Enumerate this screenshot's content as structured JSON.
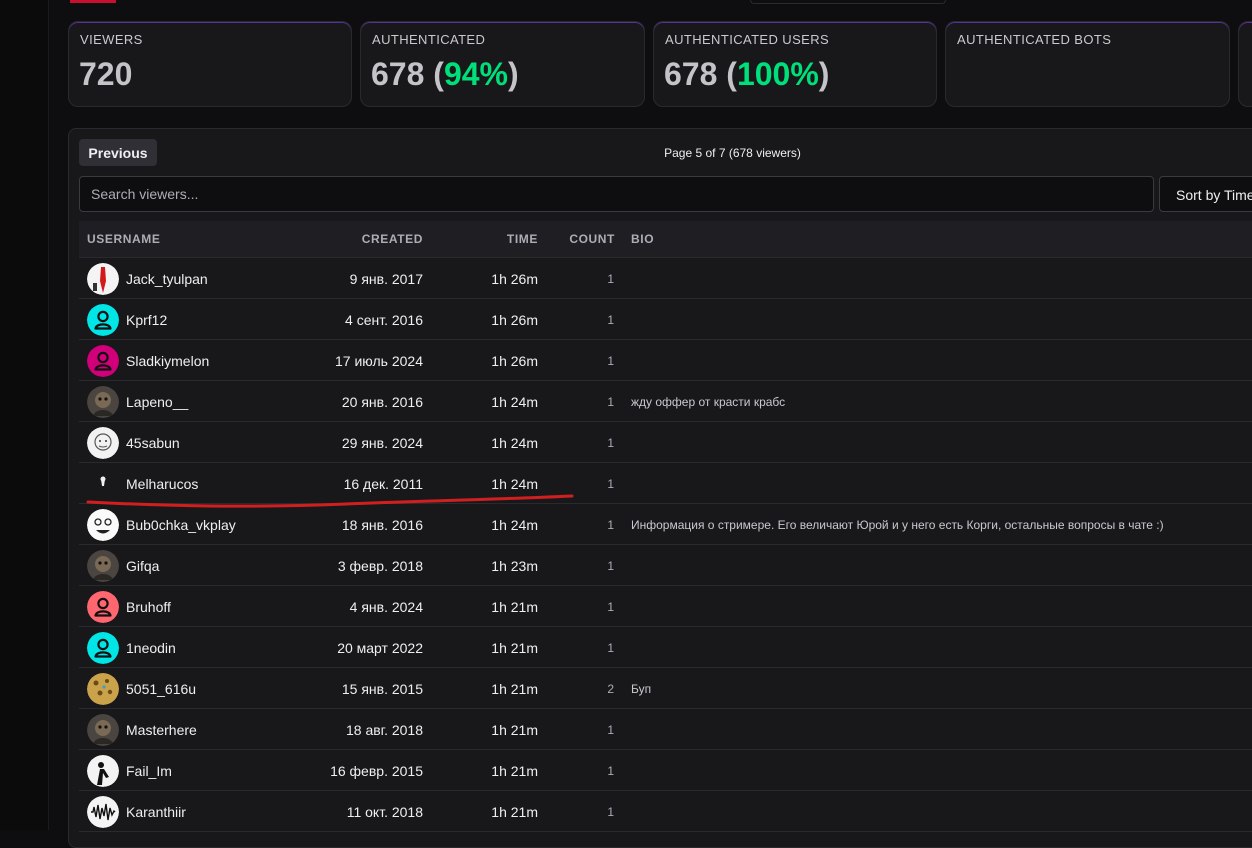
{
  "stats": [
    {
      "label": "VIEWERS",
      "value": "720",
      "pct": ""
    },
    {
      "label": "AUTHENTICATED",
      "value": "678",
      "pct": "94%"
    },
    {
      "label": "AUTHENTICATED USERS",
      "value": "678",
      "pct": "100%"
    },
    {
      "label": "AUTHENTICATED BOTS",
      "value": "",
      "pct": ""
    }
  ],
  "pagination": {
    "previous_label": "Previous",
    "page_info": "Page 5 of 7 (678 viewers)"
  },
  "search": {
    "placeholder": "Search viewers..."
  },
  "sort": {
    "label": "Sort by Time"
  },
  "table": {
    "headers": {
      "username": "USERNAME",
      "created": "CREATED",
      "time": "TIME",
      "count": "COUNT",
      "bio": "BIO"
    },
    "rows": [
      {
        "username": "Jack_tyulpan",
        "created": "9 янв. 2017",
        "time": "1h 26m",
        "count": "1",
        "bio": "",
        "avatar": "red-figure-avatar"
      },
      {
        "username": "Kprf12",
        "created": "4 сент. 2016",
        "time": "1h 26m",
        "count": "1",
        "bio": "",
        "avatar": "default-user-avatar"
      },
      {
        "username": "Sladkiymelon",
        "created": "17 июль 2024",
        "time": "1h 26m",
        "count": "1",
        "bio": "",
        "avatar": "default-user-avatar"
      },
      {
        "username": "Lapeno__",
        "created": "20 янв. 2016",
        "time": "1h 24m",
        "count": "1",
        "bio": "жду оффер от красти крабс",
        "avatar": "photo-avatar"
      },
      {
        "username": "45sabun",
        "created": "29 янв. 2024",
        "time": "1h 24m",
        "count": "1",
        "bio": "",
        "avatar": "drawing-avatar"
      },
      {
        "username": "Melharucos",
        "created": "16 дек. 2011",
        "time": "1h 24m",
        "count": "1",
        "bio": "",
        "avatar": "dark-avatar"
      },
      {
        "username": "Bub0chka_vkplay",
        "created": "18 янв. 2016",
        "time": "1h 24m",
        "count": "1",
        "bio": "Информация о стримере. Его величают Юрой и у него есть Корги, остальные вопросы в чате :)",
        "avatar": "meme-face-avatar"
      },
      {
        "username": "Gifqa",
        "created": "3 февр. 2018",
        "time": "1h 23m",
        "count": "1",
        "bio": "",
        "avatar": "photo-avatar"
      },
      {
        "username": "Bruhoff",
        "created": "4 янв. 2024",
        "time": "1h 21m",
        "count": "1",
        "bio": "",
        "avatar": "default-user-avatar"
      },
      {
        "username": "1neodin",
        "created": "20 март 2022",
        "time": "1h 21m",
        "count": "1",
        "bio": "",
        "avatar": "default-user-avatar"
      },
      {
        "username": "5051_616u",
        "created": "15 янв. 2015",
        "time": "1h 21m",
        "count": "2",
        "bio": "Буп",
        "avatar": "leopard-avatar"
      },
      {
        "username": "Masterhere",
        "created": "18 авг. 2018",
        "time": "1h 21m",
        "count": "1",
        "bio": "",
        "avatar": "photo-avatar"
      },
      {
        "username": "Fail_Im",
        "created": "16 февр. 2015",
        "time": "1h 21m",
        "count": "1",
        "bio": "",
        "avatar": "silhouette-avatar"
      },
      {
        "username": "Karanthiir",
        "created": "11 окт. 2018",
        "time": "1h 21m",
        "count": "1",
        "bio": "",
        "avatar": "soundwave-avatar"
      }
    ]
  },
  "colors": {
    "accent_purple": "#9146ff",
    "percent_green": "#00e07a",
    "annotation_red": "#d11f1f",
    "cyan_avatar": "#00e5e5",
    "magenta_avatar": "#d1007a",
    "coral_avatar": "#ff6670"
  }
}
